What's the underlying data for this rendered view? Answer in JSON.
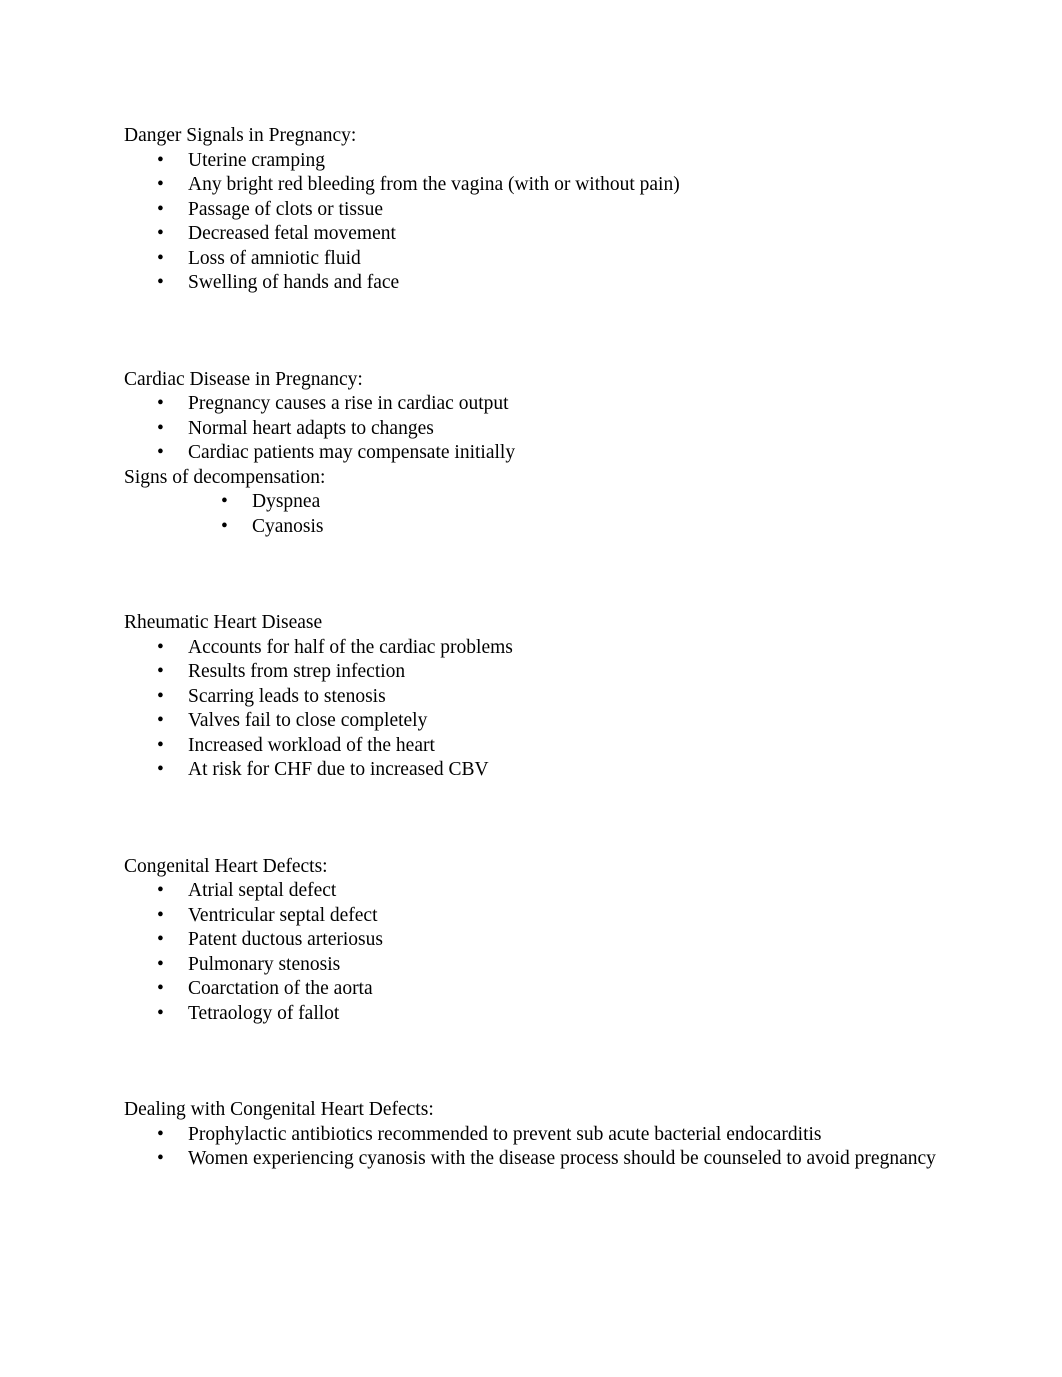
{
  "document": {
    "bullet_glyph": "•",
    "text_color": "#000000",
    "page_background": "#ffffff",
    "sections": [
      {
        "heading": "Danger Signals in Pregnancy:",
        "bullets": [
          "Uterine cramping",
          "Any bright red bleeding from the vagina (with or without pain)",
          "Passage of clots or tissue",
          "Decreased fetal movement",
          "Loss of amniotic fluid",
          "Swelling of hands and face"
        ]
      },
      {
        "heading": "Cardiac Disease in Pregnancy:",
        "bullets": [
          "Pregnancy causes a rise in cardiac output",
          "Normal heart adapts to changes",
          "Cardiac patients may compensate initially"
        ],
        "subheading": "Signs of decompensation:",
        "sub_bullets": [
          "Dyspnea",
          "Cyanosis"
        ]
      },
      {
        "heading": "Rheumatic Heart Disease",
        "bullets": [
          "Accounts for half of the cardiac problems",
          "Results from strep infection",
          "Scarring leads to stenosis",
          "Valves fail to close completely",
          "Increased workload of the heart",
          "At risk for CHF due to increased CBV"
        ]
      },
      {
        "heading": "Congenital Heart Defects:",
        "bullets": [
          "Atrial septal defect",
          "Ventricular septal defect",
          "Patent ductous arteriosus",
          "Pulmonary stenosis",
          "Coarctation of the aorta",
          "Tetraology of fallot"
        ]
      },
      {
        "heading": "Dealing with Congenital Heart Defects:",
        "bullets": [
          "Prophylactic antibiotics recommended to prevent sub acute bacterial endocarditis",
          "Women experiencing cyanosis with the disease process should be counseled to avoid pregnancy"
        ]
      }
    ]
  }
}
